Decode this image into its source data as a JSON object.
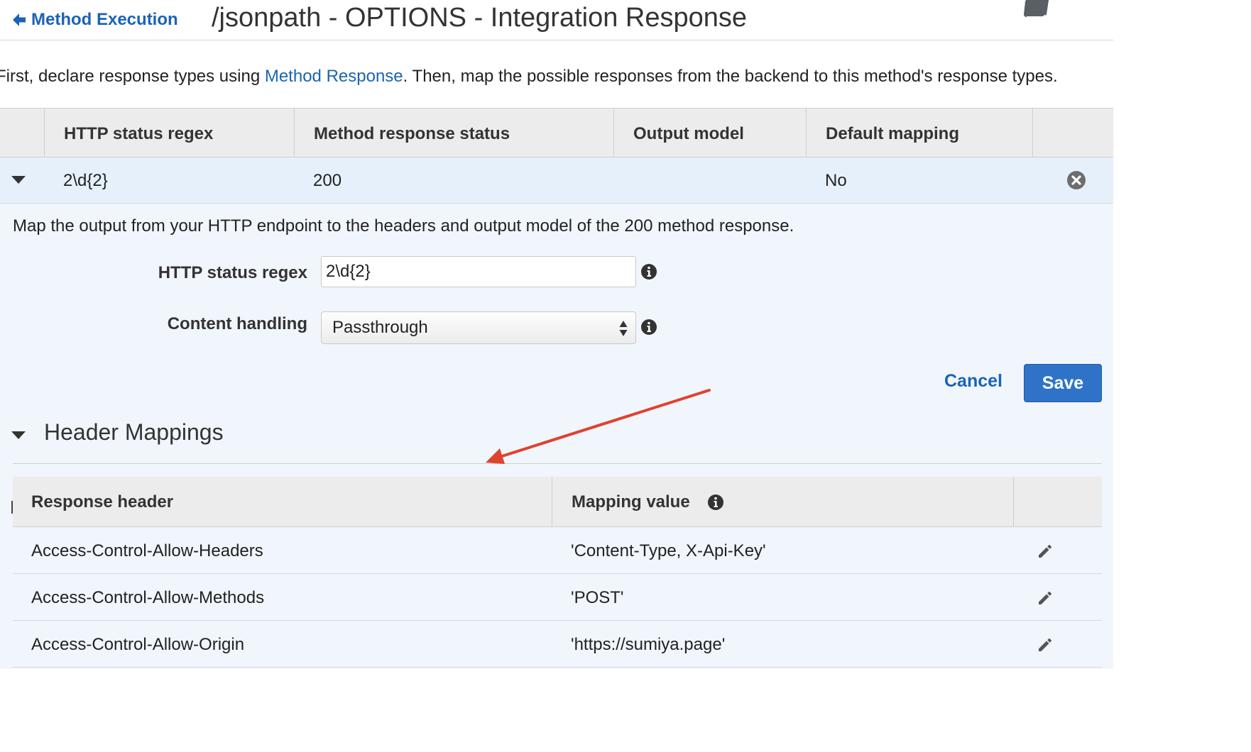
{
  "header": {
    "back_label": "Method Execution",
    "title": "/jsonpath - OPTIONS - Integration Response",
    "help_icon": "book-icon"
  },
  "intro": {
    "before": "First, declare response types using ",
    "link": "Method Response",
    "after": ". Then, map the possible responses from the backend to this method's response types."
  },
  "responses_table": {
    "columns": [
      "HTTP status regex",
      "Method response status",
      "Output model",
      "Default mapping"
    ],
    "rows": [
      {
        "regex": "2\\d{2}",
        "status": "200",
        "output_model": "",
        "default_mapping": "No",
        "expanded": true
      }
    ]
  },
  "edit_panel": {
    "description": "Map the output from your HTTP endpoint to the headers and output model of the 200 method response.",
    "regex_label": "HTTP status regex",
    "regex_value": "2\\d{2}",
    "content_label": "Content handling",
    "content_value": "Passthrough",
    "cancel_label": "Cancel",
    "save_label": "Save"
  },
  "header_mappings": {
    "title": "Header Mappings",
    "columns": [
      "Response header",
      "Mapping value"
    ],
    "rows": [
      {
        "header": "Access-Control-Allow-Headers",
        "value": "'Content-Type, X-Api-Key'"
      },
      {
        "header": "Access-Control-Allow-Methods",
        "value": "'POST'"
      },
      {
        "header": "Access-Control-Allow-Origin",
        "value": "'https://sumiya.page'"
      }
    ]
  },
  "colors": {
    "link": "#1a64b5",
    "save_button": "#2e73c7",
    "annotation_arrow": "#e0422f",
    "selected_row": "#e6f0fb",
    "panel": "#f0f6fc"
  }
}
